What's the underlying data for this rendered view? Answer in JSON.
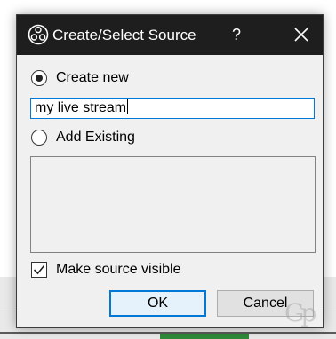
{
  "window": {
    "title": "Create/Select Source",
    "help_label": "?",
    "app_icon": "obs-logo-icon",
    "close_icon": "close-icon"
  },
  "options": {
    "create_new_label": "Create new",
    "create_new_selected": true,
    "add_existing_label": "Add Existing",
    "add_existing_selected": false
  },
  "name_input": {
    "value": "my live stream"
  },
  "existing_sources": [],
  "visibility": {
    "label": "Make source visible",
    "checked": true
  },
  "buttons": {
    "ok_label": "OK",
    "cancel_label": "Cancel"
  },
  "watermark": {
    "text": "Gp"
  },
  "colors": {
    "titlebar_bg": "#1e1e1e",
    "focus_accent": "#0078d7"
  }
}
